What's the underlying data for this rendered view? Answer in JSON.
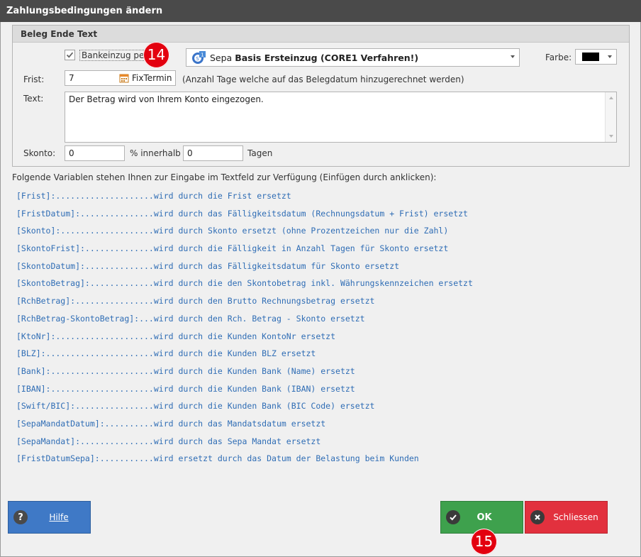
{
  "window": {
    "title": "Zahlungsbedingungen ändern"
  },
  "group": {
    "title": "Beleg Ende Text",
    "bankeinzug_label": "Bankeinzug per",
    "bankeinzug_checked": true,
    "sepa_prefix": "Sepa",
    "sepa_value": "Basis Ersteinzug (CORE1 Verfahren!)",
    "farbe_label": "Farbe:",
    "farbe_value": "#000000",
    "frist_label": "Frist:",
    "frist_value": "7",
    "fixtermin_label": "FixTermin",
    "frist_hint": "(Anzahl Tage welche auf das Belegdatum hinzugerechnet werden)",
    "text_label": "Text:",
    "text_value": "Der Betrag wird von Ihrem Konto eingezogen.",
    "skonto_label": "Skonto:",
    "skonto_value": "0",
    "innerhalb_label": "% innerhalb",
    "tage_value": "0",
    "tagen_label": "Tagen"
  },
  "variables": {
    "intro": "Folgende Variablen stehen Ihnen zur Eingabe im Textfeld zur Verfügung (Einfügen durch anklicken):",
    "items": [
      "[Frist]:....................wird durch die Frist ersetzt",
      "[FristDatum]:...............wird durch das Fälligkeitsdatum (Rechnungsdatum + Frist) ersetzt",
      "[Skonto]:...................wird durch Skonto ersetzt (ohne Prozentzeichen nur die Zahl)",
      "[SkontoFrist]:..............wird durch die Fälligkeit in Anzahl Tagen für Skonto ersetzt",
      "[SkontoDatum]:..............wird durch das Fälligkeitsdatum für Skonto ersetzt",
      "[SkontoBetrag]:.............wird durch die den Skontobetrag inkl. Währungskennzeichen ersetzt",
      "[RchBetrag]:................wird durch den Brutto Rechnungsbetrag ersetzt",
      "[RchBetrag-SkontoBetrag]:...wird durch den Rch. Betrag - Skonto ersetzt",
      "[KtoNr]:....................wird durch die Kunden KontoNr ersetzt",
      "[BLZ]:......................wird durch die Kunden BLZ ersetzt",
      "[Bank]:.....................wird durch die Kunden Bank (Name) ersetzt",
      "[IBAN]:.....................wird durch die Kunden Bank (IBAN) ersetzt",
      "[Swift/BIC]:................wird durch die Kunden Bank (BIC Code) ersetzt",
      "[SepaMandatDatum]:..........wird durch das Mandatsdatum ersetzt",
      "[SepaMandat]:...............wird durch das Sepa Mandat ersetzt",
      "[FristDatumSepa]:...........wird ersetzt durch das Datum der Belastung beim Kunden"
    ]
  },
  "buttons": {
    "help": "Hilfe",
    "ok": "OK",
    "close": "Schliessen"
  },
  "annotations": {
    "badge_14": "14",
    "badge_15": "15"
  },
  "colors": {
    "help": "#3f79c6",
    "ok": "#3ea14d",
    "close": "#e2313e",
    "variable_text": "#2f6db5"
  }
}
